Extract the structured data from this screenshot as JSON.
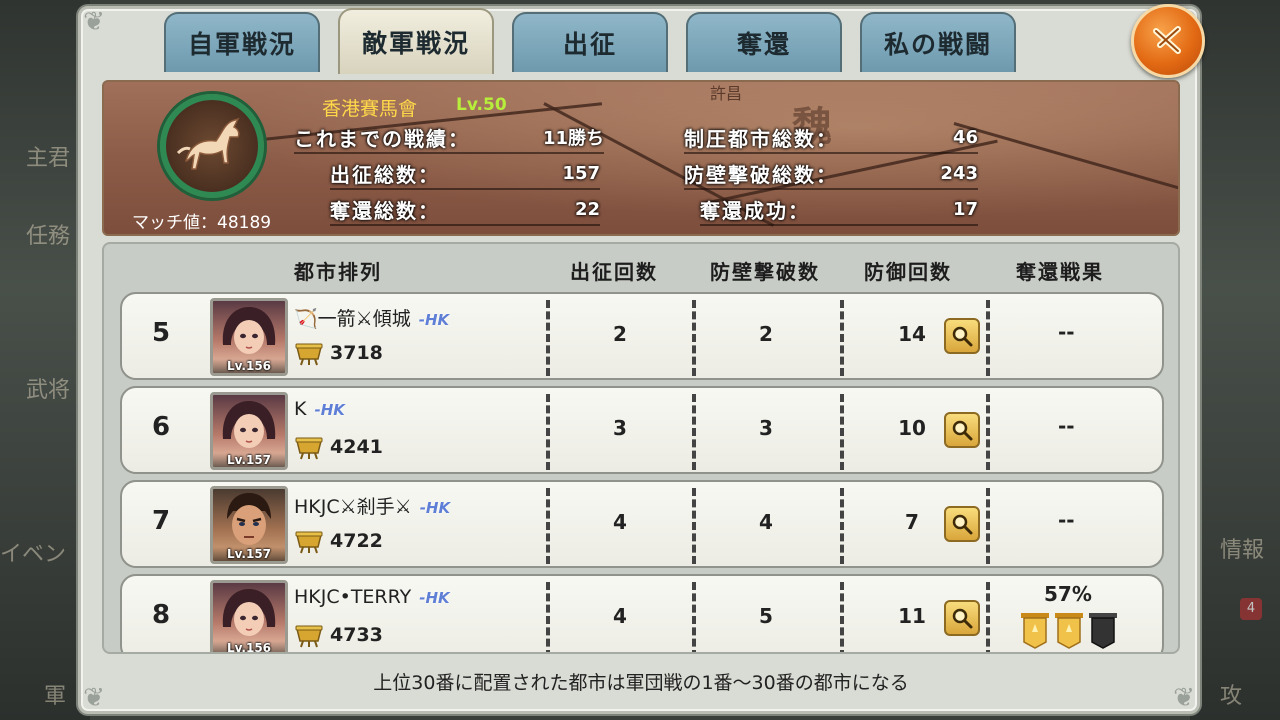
{
  "background": {
    "left_labels": [
      "主君",
      "任務",
      "武将",
      "イベン",
      "軍"
    ],
    "right_labels": [
      "情報",
      "攻"
    ],
    "right_badge": "4"
  },
  "tabs": [
    {
      "label": "自軍戦況",
      "active": false
    },
    {
      "label": "敵軍戦況",
      "active": true
    },
    {
      "label": "出征",
      "active": false
    },
    {
      "label": "奪還",
      "active": false
    },
    {
      "label": "私の戦闘",
      "active": false
    }
  ],
  "profile": {
    "name": "香港賽馬會",
    "level": "Lv.50",
    "match_value": "マッチ値：48189",
    "map_labels": [
      "許昌",
      "魏"
    ],
    "stats_left": [
      {
        "label": "これまでの戦績：",
        "value": "11勝ち"
      },
      {
        "label": "出征総数：",
        "value": "157"
      },
      {
        "label": "奪還総数：",
        "value": "22"
      }
    ],
    "stats_right": [
      {
        "label": "制圧都市総数：",
        "value": "46"
      },
      {
        "label": "防壁撃破総数：",
        "value": "243"
      },
      {
        "label": "奪還成功：",
        "value": "17"
      }
    ]
  },
  "columns": {
    "city_order": "都市排列",
    "sorties": "出征回数",
    "wall_breaks": "防壁撃破数",
    "defenses": "防御回数",
    "recapture": "奪還戦果"
  },
  "rows": [
    {
      "rank": "5",
      "level": "Lv.156",
      "name": "一箭⚔傾城",
      "server": "-HK",
      "power": "3718",
      "sorties": "2",
      "wall_breaks": "2",
      "defenses": "14",
      "recapture": "--",
      "avatar": "female"
    },
    {
      "rank": "6",
      "level": "Lv.157",
      "name": "K",
      "server": "-HK",
      "power": "4241",
      "sorties": "3",
      "wall_breaks": "3",
      "defenses": "10",
      "recapture": "--",
      "avatar": "female"
    },
    {
      "rank": "7",
      "level": "Lv.157",
      "name": "HKJC⚔剎手⚔",
      "server": "-HK",
      "power": "4722",
      "sorties": "4",
      "wall_breaks": "4",
      "defenses": "7",
      "recapture": "--",
      "avatar": "male"
    },
    {
      "rank": "8",
      "level": "Lv.156",
      "name": "HKJC•TERRY",
      "server": "-HK",
      "power": "4733",
      "sorties": "4",
      "wall_breaks": "5",
      "defenses": "11",
      "recapture": "57%",
      "avatar": "female",
      "banners": [
        "gold",
        "gold",
        "black"
      ]
    }
  ],
  "footer_note": "上位30番に配置された都市は軍団戦の1番～30番の都市になる",
  "colors": {
    "tab_active": "#e9e5d1",
    "tab_inactive": "#7fa9bc",
    "close_orange": "#e36a14",
    "level_green": "#b7ee3c",
    "name_yellow": "#ffd84a",
    "server_blue": "#5f7fd6"
  }
}
